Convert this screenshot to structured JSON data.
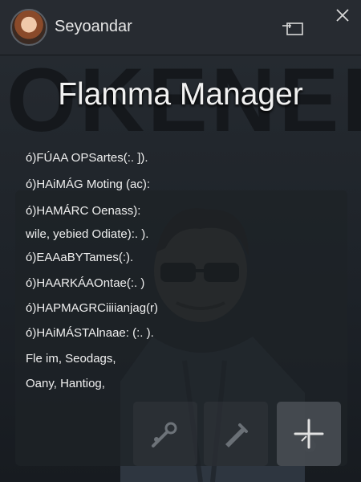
{
  "window": {
    "app_name": "Seyoandar",
    "title": "Flamma Manager"
  },
  "panel": {
    "lines": [
      "ó)FÚAA OPSartes(:. ]).",
      "ó)HAiMÁG Moting (ac):",
      "ó)HAMÁRC Oenass):",
      "wile, yebied Odiate):. ).",
      "ó)EAAaBYTames(:).",
      "ó)HAARKÁAOntae(:. )",
      "ó)HAPMAGRCiiiianjag(r)",
      "ó)HAiMÁSTAlnaae: (:. ).",
      "Fle im, Seodags,",
      "Oany, Hantiog,"
    ]
  },
  "background_text": "OKENEH",
  "icons": {
    "window_restore": "window-restore-icon",
    "close": "close-icon",
    "tool_1": "brush-icon",
    "tool_2": "dropper-icon",
    "tool_3": "crosshair-icon"
  }
}
